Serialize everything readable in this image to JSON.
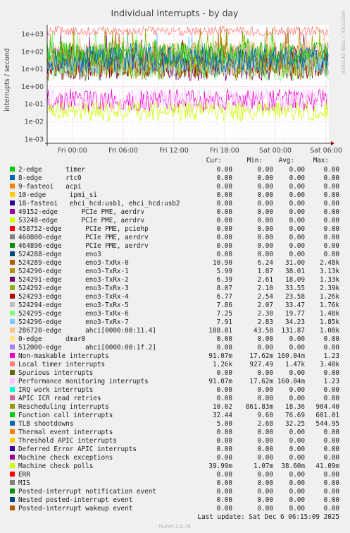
{
  "chart_data": {
    "type": "line",
    "title": "Individual interrupts - by day",
    "ylabel": "interrupts / second",
    "ylog": true,
    "ylim": [
      0.0005,
      3000
    ],
    "yticks": [
      "1e+03",
      "1e+02",
      "1e+01",
      "1e+00",
      "1e-01",
      "1e-02",
      "1e-03"
    ],
    "xticks": [
      "Fri 00:00",
      "Fri 06:00",
      "Fri 12:00",
      "Fri 18:00",
      "Sat 00:00",
      "Sat 06:00"
    ],
    "grid": true,
    "side_label": "RRDTOOL / TOBI OETIKER",
    "columns": [
      "Cur:",
      "Min:",
      "Avg:",
      "Max:"
    ],
    "series": [
      {
        "name": "2-edge      timer",
        "color": "#00cc00",
        "cur": "0.00",
        "min": "0.00",
        "avg": "0.00",
        "max": "0.00"
      },
      {
        "name": "8-edge      rtc0",
        "color": "#0066b3",
        "cur": "0.00",
        "min": "0.00",
        "avg": "0.00",
        "max": "0.00"
      },
      {
        "name": "9-fasteoi   acpi",
        "color": "#ff8000",
        "cur": "0.00",
        "min": "0.00",
        "avg": "0.00",
        "max": "0.00"
      },
      {
        "name": "10-edge      ipmi_si",
        "color": "#ffcc00",
        "cur": "0.00",
        "min": "0.00",
        "avg": "0.00",
        "max": "0.00"
      },
      {
        "name": "18-fasteoi   ehci_hcd:usb1, ehci_hcd:usb2",
        "color": "#330099",
        "cur": "0.00",
        "min": "0.00",
        "avg": "0.00",
        "max": "0.00"
      },
      {
        "name": "49152-edge      PCIe PME, aerdrv",
        "color": "#990099",
        "cur": "0.00",
        "min": "0.00",
        "avg": "0.00",
        "max": "0.00"
      },
      {
        "name": "53248-edge      PCIe PME, aerdrv",
        "color": "#ccff00",
        "cur": "0.00",
        "min": "0.00",
        "avg": "0.00",
        "max": "0.00"
      },
      {
        "name": "458752-edge      PCIe PME, pciehp",
        "color": "#ff0000",
        "cur": "0.00",
        "min": "0.00",
        "avg": "0.00",
        "max": "0.00"
      },
      {
        "name": "460800-edge      PCIe PME, aerdrv",
        "color": "#808080",
        "cur": "0.00",
        "min": "0.00",
        "avg": "0.00",
        "max": "0.00"
      },
      {
        "name": "464896-edge      PCIe PME, aerdrv",
        "color": "#008f00",
        "cur": "0.00",
        "min": "0.00",
        "avg": "0.00",
        "max": "0.00"
      },
      {
        "name": "524288-edge      eno3",
        "color": "#00487d",
        "cur": "0.00",
        "min": "0.00",
        "avg": "0.00",
        "max": "0.00"
      },
      {
        "name": "524289-edge      eno3-TxRx-0",
        "color": "#b35a00",
        "cur": "10.90",
        "min": "6.24",
        "avg": "31.00",
        "max": "2.48k"
      },
      {
        "name": "524290-edge      eno3-TxRx-1",
        "color": "#b38f00",
        "cur": "5.99",
        "min": "1.87",
        "avg": "38.01",
        "max": "3.13k"
      },
      {
        "name": "524291-edge      eno3-TxRx-2",
        "color": "#6b006b",
        "cur": "6.39",
        "min": "2.61",
        "avg": "18.09",
        "max": "1.33k"
      },
      {
        "name": "524292-edge      eno3-TxRx-3",
        "color": "#8fb300",
        "cur": "8.07",
        "min": "2.10",
        "avg": "33.55",
        "max": "2.39k"
      },
      {
        "name": "524293-edge      eno3-TxRx-4",
        "color": "#b30000",
        "cur": "6.77",
        "min": "2.54",
        "avg": "23.58",
        "max": "1.26k"
      },
      {
        "name": "524294-edge      eno3-TxRx-5",
        "color": "#bebebe",
        "cur": "7.86",
        "min": "2.07",
        "avg": "33.47",
        "max": "1.76k"
      },
      {
        "name": "524295-edge      eno3-TxRx-6",
        "color": "#80ff80",
        "cur": "7.25",
        "min": "2.30",
        "avg": "19.77",
        "max": "1.48k"
      },
      {
        "name": "524296-edge      eno3-TxRx-7",
        "color": "#80c9ff",
        "cur": "7.91",
        "min": "2.83",
        "avg": "34.23",
        "max": "1.85k"
      },
      {
        "name": "286720-edge      ahci[0000:00:11.4]",
        "color": "#ffc080",
        "cur": "108.01",
        "min": "43.58",
        "avg": "131.87",
        "max": "1.08k"
      },
      {
        "name": "0-edge      dmar0",
        "color": "#ffe680",
        "cur": "0.00",
        "min": "0.00",
        "avg": "0.00",
        "max": "0.00"
      },
      {
        "name": "512000-edge      ahci[0000:00:1f.2]",
        "color": "#aa80ff",
        "cur": "0.00",
        "min": "0.00",
        "avg": "0.00",
        "max": "0.00"
      },
      {
        "name": "Non-maskable interrupts",
        "color": "#ee00cc",
        "cur": "91.07m",
        "min": "17.62m",
        "avg": "160.04m",
        "max": "1.23"
      },
      {
        "name": "Local timer interrupts",
        "color": "#ff8080",
        "cur": "1.26k",
        "min": "927.49",
        "avg": "1.47k",
        "max": "3.40k"
      },
      {
        "name": "Spurious interrupts",
        "color": "#666600",
        "cur": "0.00",
        "min": "0.00",
        "avg": "0.00",
        "max": "0.00"
      },
      {
        "name": "Performance monitoring interrupts",
        "color": "#ffbfff",
        "cur": "91.07m",
        "min": "17.62m",
        "avg": "160.04m",
        "max": "1.23"
      },
      {
        "name": "IRQ work interrupts",
        "color": "#00ffcc",
        "cur": "0.00",
        "min": "0.00",
        "avg": "0.00",
        "max": "0.00"
      },
      {
        "name": "APIC ICR read retries",
        "color": "#cc6699",
        "cur": "0.00",
        "min": "0.00",
        "avg": "0.00",
        "max": "0.00"
      },
      {
        "name": "Rescheduling interrupts",
        "color": "#999900",
        "cur": "10.02",
        "min": "861.83m",
        "avg": "18.36",
        "max": "904.40"
      },
      {
        "name": "Function call interrupts",
        "color": "#00cc00",
        "cur": "32.44",
        "min": "9.60",
        "avg": "76.69",
        "max": "601.01"
      },
      {
        "name": "TLB shootdowns",
        "color": "#0066b3",
        "cur": "5.00",
        "min": "2.68",
        "avg": "32.25",
        "max": "544.95"
      },
      {
        "name": "Thermal event interrupts",
        "color": "#ff8000",
        "cur": "0.00",
        "min": "0.00",
        "avg": "0.00",
        "max": "0.00"
      },
      {
        "name": "Threshold APIC interrupts",
        "color": "#ffcc00",
        "cur": "0.00",
        "min": "0.00",
        "avg": "0.00",
        "max": "0.00"
      },
      {
        "name": "Deferred Error APIC interrupts",
        "color": "#330099",
        "cur": "0.00",
        "min": "0.00",
        "avg": "0.00",
        "max": "0.00"
      },
      {
        "name": "Machine check exceptions",
        "color": "#990099",
        "cur": "0.00",
        "min": "0.00",
        "avg": "0.00",
        "max": "0.00"
      },
      {
        "name": "Machine check polls",
        "color": "#ccff00",
        "cur": "39.99m",
        "min": "1.07m",
        "avg": "38.60m",
        "max": "41.09m"
      },
      {
        "name": "ERR",
        "color": "#ff0000",
        "cur": "0.00",
        "min": "0.00",
        "avg": "0.00",
        "max": "0.00"
      },
      {
        "name": "MIS",
        "color": "#808080",
        "cur": "0.00",
        "min": "0.00",
        "avg": "0.00",
        "max": "0.00"
      },
      {
        "name": "Posted-interrupt notification event",
        "color": "#008f00",
        "cur": "0.00",
        "min": "0.00",
        "avg": "0.00",
        "max": "0.00"
      },
      {
        "name": "Nested posted-interrupt event",
        "color": "#00487d",
        "cur": "0.00",
        "min": "0.00",
        "avg": "0.00",
        "max": "0.00"
      },
      {
        "name": "Posted-interrupt wakeup event",
        "color": "#b35a00",
        "cur": "0.00",
        "min": "0.00",
        "avg": "0.00",
        "max": "0.00"
      }
    ],
    "last_update": "Last update: Sat Dec  6 06:15:09 2025",
    "footer": "Munin 2.0.76"
  }
}
